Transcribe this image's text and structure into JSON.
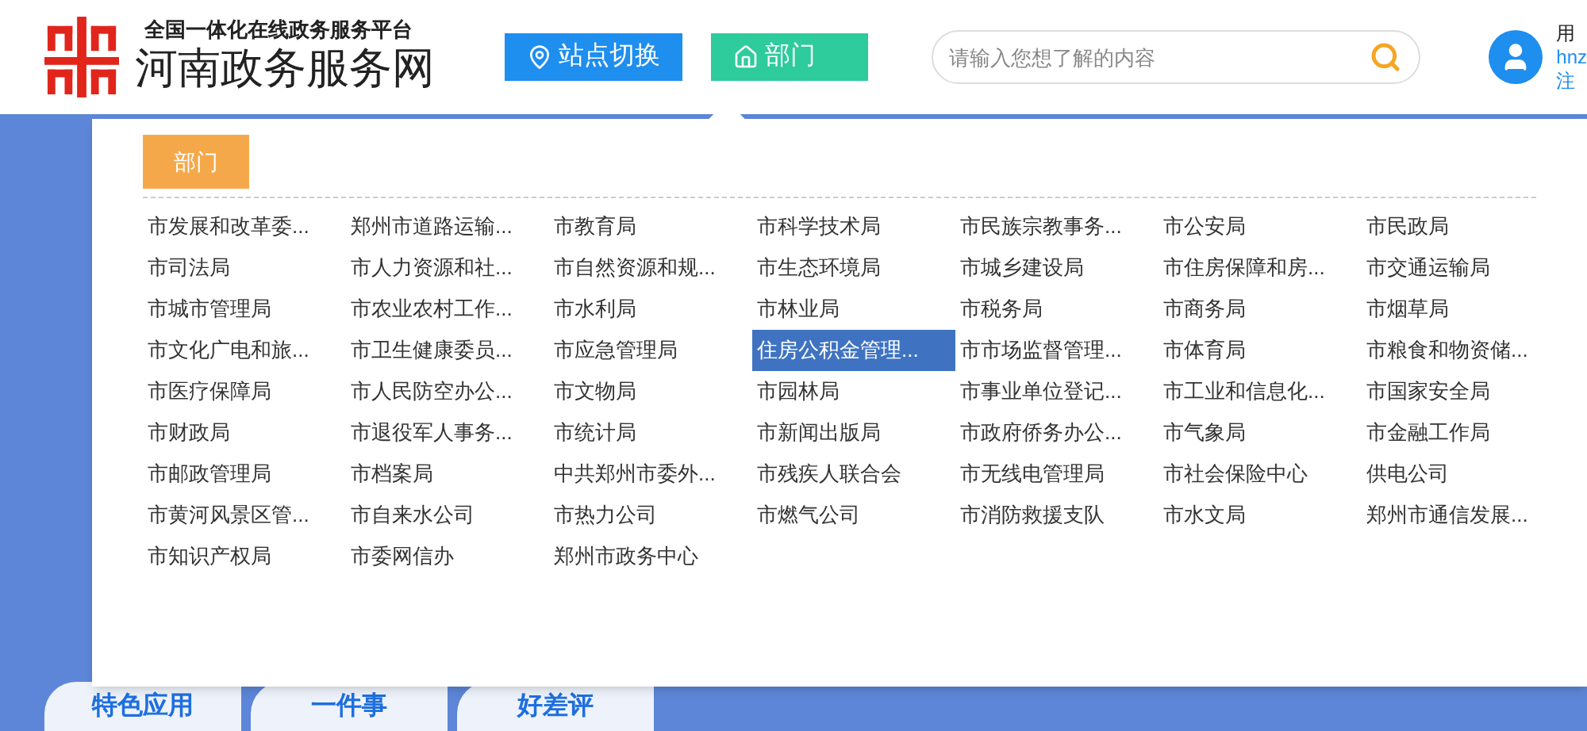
{
  "header": {
    "subtitle": "全国一体化在线政务服务平台",
    "title": "河南政务服务网",
    "nav": [
      {
        "label": "站点切换",
        "kind": "location",
        "selected": false
      },
      {
        "label": "部门",
        "kind": "home",
        "selected": true
      }
    ],
    "search": {
      "placeholder": "请输入您想了解的内容"
    },
    "user": {
      "name": "用",
      "account": "hnz",
      "logout": "注"
    }
  },
  "panel": {
    "tab": "部门",
    "items": [
      {
        "label": "市发展和改革委...",
        "selected": false
      },
      {
        "label": "郑州市道路运输...",
        "selected": false
      },
      {
        "label": "市教育局",
        "selected": false
      },
      {
        "label": "市科学技术局",
        "selected": false
      },
      {
        "label": "市民族宗教事务...",
        "selected": false
      },
      {
        "label": "市公安局",
        "selected": false
      },
      {
        "label": "市民政局",
        "selected": false
      },
      {
        "label": "市司法局",
        "selected": false
      },
      {
        "label": "市人力资源和社...",
        "selected": false
      },
      {
        "label": "市自然资源和规...",
        "selected": false
      },
      {
        "label": "市生态环境局",
        "selected": false
      },
      {
        "label": "市城乡建设局",
        "selected": false
      },
      {
        "label": "市住房保障和房...",
        "selected": false
      },
      {
        "label": "市交通运输局",
        "selected": false
      },
      {
        "label": "市城市管理局",
        "selected": false
      },
      {
        "label": "市农业农村工作...",
        "selected": false
      },
      {
        "label": "市水利局",
        "selected": false
      },
      {
        "label": "市林业局",
        "selected": false
      },
      {
        "label": "市税务局",
        "selected": false
      },
      {
        "label": "市商务局",
        "selected": false
      },
      {
        "label": "市烟草局",
        "selected": false
      },
      {
        "label": "市文化广电和旅...",
        "selected": false
      },
      {
        "label": "市卫生健康委员...",
        "selected": false
      },
      {
        "label": "市应急管理局",
        "selected": false
      },
      {
        "label": "住房公积金管理...",
        "selected": true
      },
      {
        "label": "市市场监督管理...",
        "selected": false
      },
      {
        "label": "市体育局",
        "selected": false
      },
      {
        "label": "市粮食和物资储...",
        "selected": false
      },
      {
        "label": "市医疗保障局",
        "selected": false
      },
      {
        "label": "市人民防空办公...",
        "selected": false
      },
      {
        "label": "市文物局",
        "selected": false
      },
      {
        "label": "市园林局",
        "selected": false
      },
      {
        "label": "市事业单位登记...",
        "selected": false
      },
      {
        "label": "市工业和信息化...",
        "selected": false
      },
      {
        "label": "市国家安全局",
        "selected": false
      },
      {
        "label": "市财政局",
        "selected": false
      },
      {
        "label": "市退役军人事务...",
        "selected": false
      },
      {
        "label": "市统计局",
        "selected": false
      },
      {
        "label": "市新闻出版局",
        "selected": false
      },
      {
        "label": "市政府侨务办公...",
        "selected": false
      },
      {
        "label": "市气象局",
        "selected": false
      },
      {
        "label": "市金融工作局",
        "selected": false
      },
      {
        "label": "市邮政管理局",
        "selected": false
      },
      {
        "label": "市档案局",
        "selected": false
      },
      {
        "label": "中共郑州市委外...",
        "selected": false
      },
      {
        "label": "市残疾人联合会",
        "selected": false
      },
      {
        "label": "市无线电管理局",
        "selected": false
      },
      {
        "label": "市社会保险中心",
        "selected": false
      },
      {
        "label": "供电公司",
        "selected": false
      },
      {
        "label": "市黄河风景区管...",
        "selected": false
      },
      {
        "label": "市自来水公司",
        "selected": false
      },
      {
        "label": "市热力公司",
        "selected": false
      },
      {
        "label": "市燃气公司",
        "selected": false
      },
      {
        "label": "市消防救援支队",
        "selected": false
      },
      {
        "label": "市水文局",
        "selected": false
      },
      {
        "label": "郑州市通信发展...",
        "selected": false
      },
      {
        "label": "市知识产权局",
        "selected": false
      },
      {
        "label": "市委网信办",
        "selected": false
      },
      {
        "label": "郑州市政务中心",
        "selected": false
      }
    ]
  },
  "tiles": [
    {
      "label": "特色应用"
    },
    {
      "label": "一件事"
    },
    {
      "label": "好差评"
    }
  ]
}
